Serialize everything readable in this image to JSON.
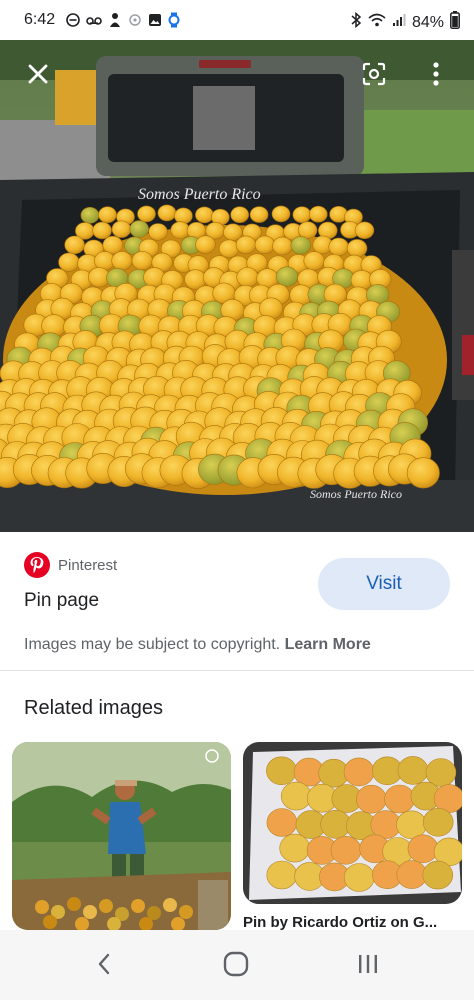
{
  "status_bar": {
    "time": "6:42",
    "battery": "84%"
  },
  "viewer": {
    "watermark_top": "Somos Puerto Rico",
    "watermark_bottom": "Somos Puerto Rico",
    "close_icon": "close-icon",
    "lens_icon": "lens-icon",
    "more_icon": "more-vert-icon"
  },
  "source": {
    "site": "Pinterest",
    "title": "Pin page",
    "visit_label": "Visit"
  },
  "copyright": {
    "text": "Images may be subject to copyright. ",
    "link": "Learn More"
  },
  "related": {
    "heading": "Related images",
    "items": [
      {
        "caption": ""
      },
      {
        "caption": "Pin by Ricardo Ortiz on G..."
      }
    ]
  },
  "colors": {
    "accent": "#1a5fb4",
    "visit_bg": "#dfe9f8",
    "pinterest": "#e60023"
  }
}
